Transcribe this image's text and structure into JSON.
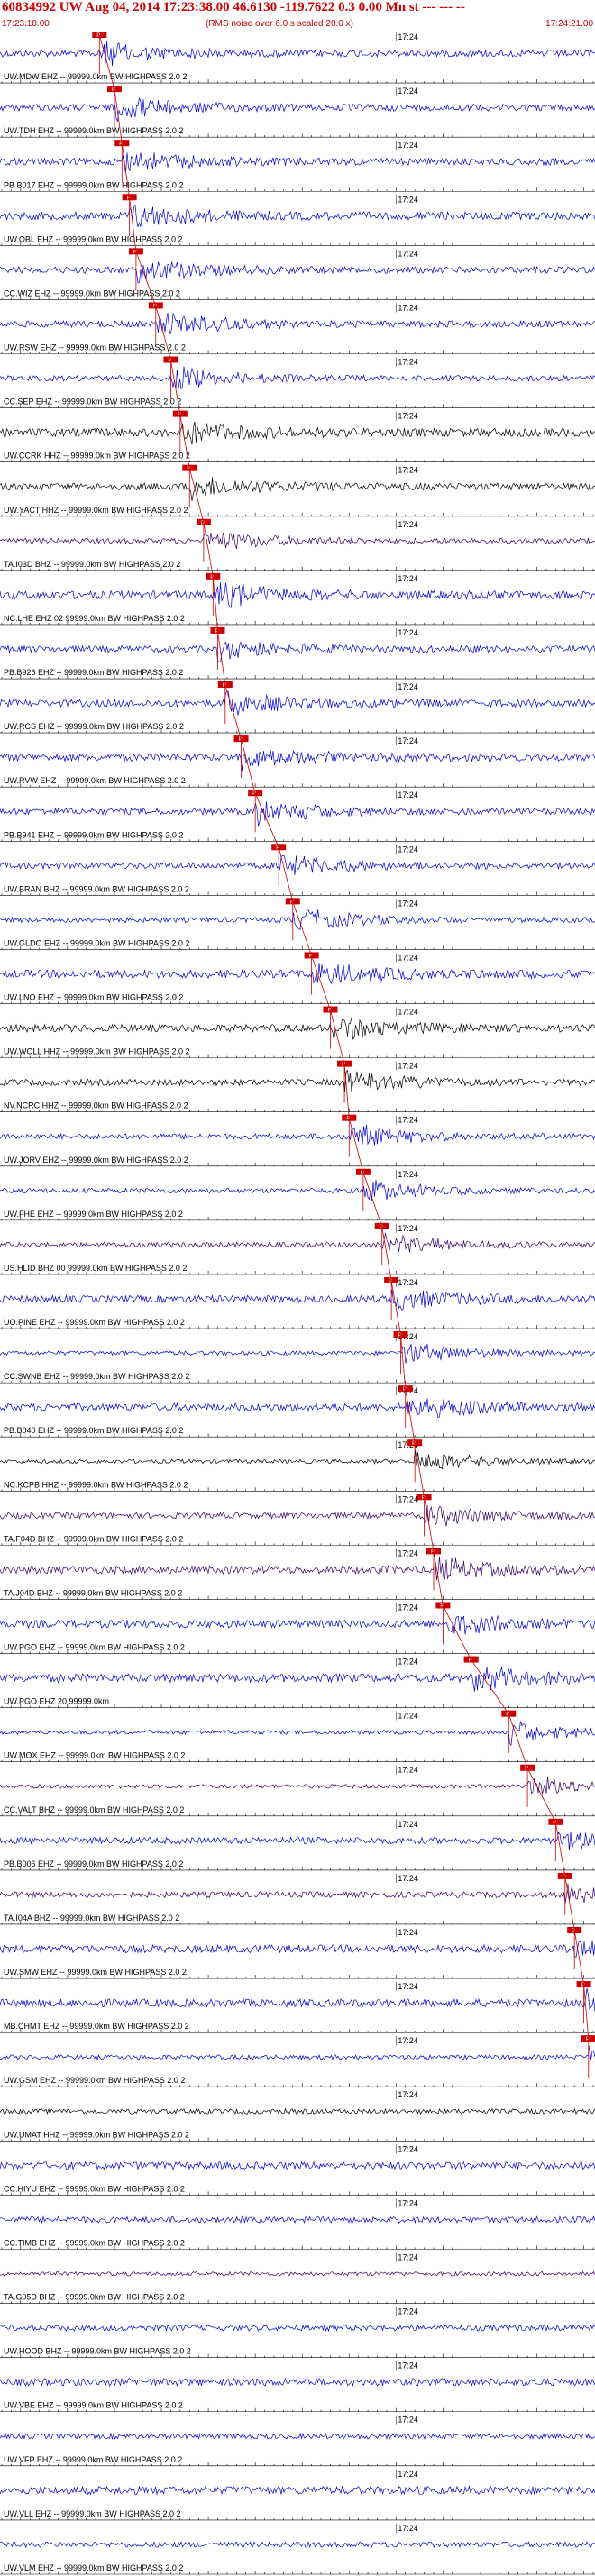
{
  "header": {
    "title": "60834992 UW Aug 04, 2014 17:23:38.00   46.6130 -119.7622  0.3 0.00 Mn st --- --- --",
    "start_time": "17:23:18.00",
    "end_time": "17:24:21.00",
    "rms_note": "(RMS noise over 6.0 s scaled 20.0 x)"
  },
  "minute_label": "17:24",
  "colors": {
    "pick": "#cc0000",
    "axis": "#000000",
    "label": "#000000"
  },
  "chart_data": {
    "type": "line",
    "description_of_axes": "record section: one seismogram trace per station, time along x",
    "x_range": [
      "17:23:18.00",
      "17:24:21.00"
    ],
    "grid": false,
    "traces": [
      {
        "label": "UW.MDW EHZ -- 99999.0km BW  HIGHPASS  2.0  2",
        "color": "#0000cc",
        "pick": "17:23:28.4",
        "pick_label": "P"
      },
      {
        "label": "UW.TDH EHZ -- 99999.0km BW  HIGHPASS  2.0  2",
        "color": "#0000cc",
        "pick": "17:23:30.0",
        "pick_label": "P"
      },
      {
        "label": "PB.B017 EHZ -- 99999.0km BW  HIGHPASS  2.0  2",
        "color": "#0000cc",
        "pick": "17:23:30.8",
        "pick_label": "P"
      },
      {
        "label": "UW.OBL EHZ -- 99999.0km BW  HIGHPASS  2.0  2",
        "color": "#0000cc",
        "pick": "17:23:31.6",
        "pick_label": "P"
      },
      {
        "label": "CC.WIZ EHZ -- 99999.0km BW  HIGHPASS  2.0  2",
        "color": "#0000cc",
        "pick": "17:23:32.3",
        "pick_label": "P"
      },
      {
        "label": "UW.RSW EHZ -- 99999.0km BW  HIGHPASS  2.0  2",
        "color": "#0000cc",
        "pick": "17:23:34.4",
        "pick_label": "P"
      },
      {
        "label": "CC.SEP EHZ -- 99999.0km BW  HIGHPASS  2.0  2",
        "color": "#0000cc",
        "pick": "17:23:36.0",
        "pick_label": "P"
      },
      {
        "label": "UW.CCRK HHZ -- 99999.0km BW  HIGHPASS  2.0  2",
        "color": "#000000",
        "pick": "17:23:37.0",
        "pick_label": "P"
      },
      {
        "label": "UW.YACT HHZ -- 99999.0km BW  HIGHPASS  2.0  2",
        "color": "#000000",
        "pick": "17:23:38.0",
        "pick_label": "P"
      },
      {
        "label": "TA.I03D BHZ -- 99999.0km BW  HIGHPASS  2.0  2",
        "color": "#330066",
        "pick": "17:23:39.5",
        "pick_label": "P"
      },
      {
        "label": "NC.LHE EHZ 02 99999.0km BW  HIGHPASS  2.0  2",
        "color": "#0000cc",
        "pick": "17:23:40.5",
        "pick_label": "P"
      },
      {
        "label": "PB.B926 EHZ -- 99999.0km BW  HIGHPASS  2.0  2",
        "color": "#0000cc",
        "pick": "17:23:41.0",
        "pick_label": "P"
      },
      {
        "label": "UW.RCS EHZ -- 99999.0km BW  HIGHPASS  2.0  2",
        "color": "#0000cc",
        "pick": "17:23:41.8",
        "pick_label": "P"
      },
      {
        "label": "UW.RVW EHZ -- 99999.0km BW  HIGHPASS  2.0  2",
        "color": "#0000cc",
        "pick": "17:23:43.5",
        "pick_label": "P"
      },
      {
        "label": "PB.B941 EHZ -- 99999.0km BW  HIGHPASS  2.0  2",
        "color": "#0000cc",
        "pick": "17:23:45.0",
        "pick_label": "P"
      },
      {
        "label": "UW.BRAN BHZ -- 99999.0km BW  HIGHPASS  2.0  2",
        "color": "#0000cc",
        "pick": "17:23:47.5",
        "pick_label": "P"
      },
      {
        "label": "UW.GLDO EHZ -- 99999.0km BW  HIGHPASS  2.0  2",
        "color": "#0000cc",
        "pick": "17:23:49.0",
        "pick_label": "P"
      },
      {
        "label": "UW.LNO EHZ -- 99999.0km BW  HIGHPASS  2.0  2",
        "color": "#0000cc",
        "pick": "17:23:51.0",
        "pick_label": "P"
      },
      {
        "label": "UW.WOLL HHZ -- 99999.0km BW  HIGHPASS  2.0  2",
        "color": "#000000",
        "pick": "17:23:53.0",
        "pick_label": "P"
      },
      {
        "label": "NV.NCRC HHZ -- 99999.0km BW  HIGHPASS  2.0  2",
        "color": "#000000",
        "pick": "17:23:54.5",
        "pick_label": "P"
      },
      {
        "label": "UW.JORV EHZ -- 99999.0km BW  HIGHPASS  2.0  2",
        "color": "#0000cc",
        "pick": "17:23:55.0",
        "pick_label": "P"
      },
      {
        "label": "UW.FHE EHZ -- 99999.0km BW  HIGHPASS  2.0  2",
        "color": "#0000cc",
        "pick": "17:23:56.5",
        "pick_label": "P"
      },
      {
        "label": "US.HLID BHZ 00 99999.0km BW  HIGHPASS  2.0  2",
        "color": "#330066",
        "pick": "17:23:58.5",
        "pick_label": "P"
      },
      {
        "label": "UO.PINE EHZ -- 99999.0km BW  HIGHPASS  2.0  2",
        "color": "#0000cc",
        "pick": "17:23:59.5",
        "pick_label": "P"
      },
      {
        "label": "CC.SWNB EHZ -- 99999.0km BW  HIGHPASS  2.0  2",
        "color": "#0000cc",
        "pick": "17:24:00.5",
        "pick_label": "P"
      },
      {
        "label": "PB.B040 EHZ -- 99999.0km BW  HIGHPASS  2.0  2",
        "color": "#0000cc",
        "pick": "17:24:01.0",
        "pick_label": "P"
      },
      {
        "label": "NC.KCPB HHZ -- 99999.0km BW  HIGHPASS  2.0  2",
        "color": "#000000",
        "pick": "17:24:02.0",
        "pick_label": "P"
      },
      {
        "label": "TA.F04D BHZ -- 99999.0km BW  HIGHPASS  2.0  2",
        "color": "#330066",
        "pick": "17:24:03.0",
        "pick_label": "P"
      },
      {
        "label": "TA.J04D BHZ -- 99999.0km BW  HIGHPASS  2.0  2",
        "color": "#330066",
        "pick": "17:24:04.0",
        "pick_label": "P"
      },
      {
        "label": "UW.PGO EHZ -- 99999.0km BW  HIGHPASS  2.0  2",
        "color": "#0000cc",
        "pick": "17:24:05.0",
        "pick_label": "P"
      },
      {
        "label": "UW.PGO EHZ 20 99999.0km",
        "color": "#0000cc",
        "pick": "17:24:08.0",
        "pick_label": "P"
      },
      {
        "label": "UW.MOX EHZ -- 99999.0km BW  HIGHPASS  2.0  2",
        "color": "#0000cc",
        "pick": "17:24:12.0",
        "pick_label": "P"
      },
      {
        "label": "CC.VALT BHZ -- 99999.0km BW  HIGHPASS  2.0  2",
        "color": "#330066",
        "pick": "17:24:14.0",
        "pick_label": "P"
      },
      {
        "label": "PB.B006 EHZ -- 99999.0km BW  HIGHPASS  2.0  2",
        "color": "#0000cc",
        "pick": "17:24:17.0",
        "pick_label": "P"
      },
      {
        "label": "TA.I04A BHZ -- 99999.0km BW  HIGHPASS  2.0  2",
        "color": "#330066",
        "pick": "17:24:18.0",
        "pick_label": "P"
      },
      {
        "label": "UW.SMW EHZ -- 99999.0km BW  HIGHPASS  2.0  2",
        "color": "#0000cc",
        "pick": "17:24:19.0",
        "pick_label": "P"
      },
      {
        "label": "MB.CHMT EHZ -- 99999.0km BW  HIGHPASS  2.0  2",
        "color": "#0000cc",
        "pick": "17:24:20.0",
        "pick_label": "P"
      },
      {
        "label": "UW.GSM EHZ -- 99999.0km BW  HIGHPASS  2.0  2",
        "color": "#0000cc",
        "pick": "17:24:20.5",
        "pick_label": "P"
      },
      {
        "label": "UW.UMAT HHZ -- 99999.0km BW  HIGHPASS  2.0  2",
        "color": "#000000",
        "pick": null,
        "pick_label": ""
      },
      {
        "label": "CC.HIYU EHZ -- 99999.0km BW  HIGHPASS  2.0  2",
        "color": "#0000cc",
        "pick": null,
        "pick_label": ""
      },
      {
        "label": "CC.TIMB EHZ -- 99999.0km BW  HIGHPASS  2.0  2",
        "color": "#0000cc",
        "pick": null,
        "pick_label": ""
      },
      {
        "label": "TA.G05D BHZ -- 99999.0km BW  HIGHPASS  2.0  2",
        "color": "#330066",
        "pick": null,
        "pick_label": ""
      },
      {
        "label": "UW.HOOD BHZ -- 99999.0km BW  HIGHPASS  2.0  2",
        "color": "#0000cc",
        "pick": null,
        "pick_label": ""
      },
      {
        "label": "UW.VBE EHZ -- 99999.0km BW  HIGHPASS  2.0  2",
        "color": "#0000cc",
        "pick": null,
        "pick_label": ""
      },
      {
        "label": "UW.VFP EHZ -- 99999.0km BW  HIGHPASS  2.0  2",
        "color": "#0000cc",
        "pick": null,
        "pick_label": ""
      },
      {
        "label": "UW.VLL EHZ -- 99999.0km BW  HIGHPASS  2.0  2",
        "color": "#0000cc",
        "pick": null,
        "pick_label": ""
      },
      {
        "label": "UW.VLM EHZ -- 99999.0km BW  HIGHPASS  2.0  2",
        "color": "#0000cc",
        "pick": null,
        "pick_label": ""
      }
    ]
  }
}
